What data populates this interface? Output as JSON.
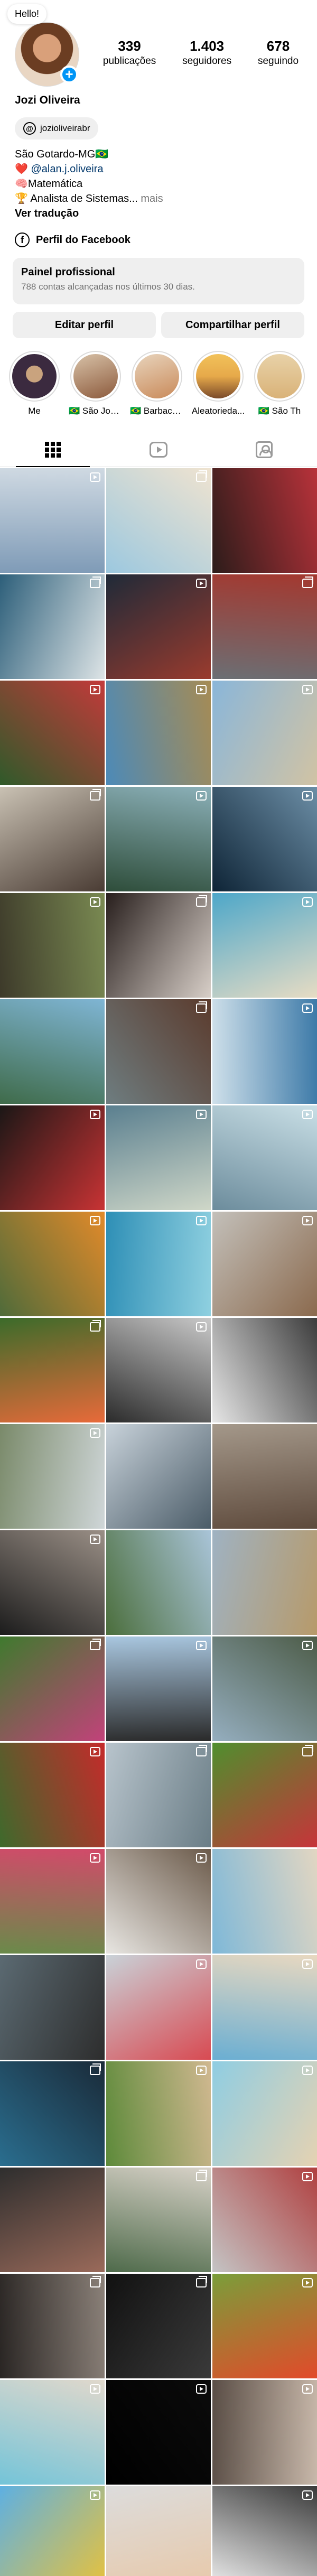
{
  "profile": {
    "note": "Hello!",
    "name": "Jozi Oliveira",
    "stats": [
      {
        "value": "339",
        "label": "publicações"
      },
      {
        "value": "1.403",
        "label": "seguidores"
      },
      {
        "value": "678",
        "label": "seguindo"
      }
    ],
    "threads_handle": "jozioliveirabr",
    "bio": {
      "line1": "São Gotardo-MG🇧🇷",
      "line2_prefix": "❤️ ",
      "line2_link": "@alan.j.oliveira",
      "line3": "🧠Matemática",
      "line4": "🏆 Analista de Sistemas...",
      "more": " mais",
      "translate": "Ver tradução"
    },
    "facebook_label": "Perfil do Facebook",
    "panel": {
      "title": "Painel profissional",
      "subtitle": "788 contas alcançadas nos últimos 30 dias."
    },
    "buttons": {
      "edit": "Editar perfil",
      "share": "Compartilhar perfil"
    }
  },
  "highlights": [
    {
      "label": "Me",
      "color": "#3b2a3f"
    },
    {
      "label": "🇧🇷 São Joã...",
      "color": "#8c5a3c"
    },
    {
      "label": "🇧🇷 Barbace...",
      "color": "#c98a5a"
    },
    {
      "label": "Aleatorieda...",
      "color": "#e6a94a"
    },
    {
      "label": "🇧🇷 São Th",
      "color": "#d9b278"
    }
  ],
  "posts": [
    {
      "c1": "#7f9bb7",
      "c2": "#cfd9e2",
      "badge": "reel"
    },
    {
      "c1": "#9cc8df",
      "c2": "#efe3d0",
      "badge": "carousel"
    },
    {
      "c1": "#2c1c1a",
      "c2": "#b8323a",
      "badge": "none"
    },
    {
      "c1": "#2d5f7a",
      "c2": "#dde4e6",
      "badge": "carousel"
    },
    {
      "c1": "#1f2a38",
      "c2": "#9a3b2e",
      "badge": "reel"
    },
    {
      "c1": "#6b6f74",
      "c2": "#a4382f",
      "badge": "carousel"
    },
    {
      "c1": "#2f5a2a",
      "c2": "#c33a3a",
      "badge": "reel"
    },
    {
      "c1": "#4c8ab8",
      "c2": "#a68b54",
      "badge": "reel"
    },
    {
      "c1": "#8ab6d9",
      "c2": "#d1c3a4",
      "badge": "reel"
    },
    {
      "c1": "#c9c1b3",
      "c2": "#4a3c34",
      "badge": "carousel"
    },
    {
      "c1": "#2e4d3a",
      "c2": "#8bb0b8",
      "badge": "reel"
    },
    {
      "c1": "#0e2436",
      "c2": "#6c8ea6",
      "badge": "reel"
    },
    {
      "c1": "#3d3a2a",
      "c2": "#7a8a52",
      "badge": "reel"
    },
    {
      "c1": "#281f1d",
      "c2": "#d8cfc8",
      "badge": "carousel"
    },
    {
      "c1": "#4da7c9",
      "c2": "#e7dcc4",
      "badge": "reel"
    },
    {
      "c1": "#3f6b4a",
      "c2": "#7fb5d4",
      "badge": "none"
    },
    {
      "c1": "#6e7d80",
      "c2": "#5b3b2d",
      "badge": "carousel"
    },
    {
      "c1": "#cfe0ea",
      "c2": "#3d7aa8",
      "badge": "reel"
    },
    {
      "c1": "#1b1716",
      "c2": "#c83334",
      "badge": "reel"
    },
    {
      "c1": "#5a7f8f",
      "c2": "#cfd7c8",
      "badge": "reel"
    },
    {
      "c1": "#6c8c9c",
      "c2": "#c9dfe6",
      "badge": "reel"
    },
    {
      "c1": "#4f6b3a",
      "c2": "#e28a2a",
      "badge": "reel"
    },
    {
      "c1": "#2e8fb6",
      "c2": "#8fd0e0",
      "badge": "reel"
    },
    {
      "c1": "#c3c0ba",
      "c2": "#8b6a4e",
      "badge": "reel"
    },
    {
      "c1": "#3b6b2a",
      "c2": "#e86a3a",
      "badge": "carousel"
    },
    {
      "c1": "#2b2b2b",
      "c2": "#c9c9c9",
      "badge": "reel"
    },
    {
      "c1": "#e6e6e6",
      "c2": "#3c3c3c",
      "badge": "none"
    },
    {
      "c1": "#7a8a6a",
      "c2": "#cfd6d8",
      "badge": "reel"
    },
    {
      "c1": "#c8d2da",
      "c2": "#4b5c68",
      "badge": "none"
    },
    {
      "c1": "#a4988a",
      "c2": "#5e4a3c",
      "badge": "none"
    },
    {
      "c1": "#1c1c1c",
      "c2": "#9a8f86",
      "badge": "reel"
    },
    {
      "c1": "#4b6e3c",
      "c2": "#a9c4d8",
      "badge": "none"
    },
    {
      "c1": "#9fb2c2",
      "c2": "#b79a6a",
      "badge": "none"
    },
    {
      "c1": "#3f7a2e",
      "c2": "#c2427a",
      "badge": "carousel"
    },
    {
      "c1": "#a9c7e0",
      "c2": "#2a2a2a",
      "badge": "reel"
    },
    {
      "c1": "#95aebf",
      "c2": "#4d5c48",
      "badge": "reel"
    },
    {
      "c1": "#3e6a2c",
      "c2": "#c42b2b",
      "badge": "reel"
    },
    {
      "c1": "#b8c4cc",
      "c2": "#6a7d86",
      "badge": "carousel"
    },
    {
      "c1": "#4f8f2e",
      "c2": "#c7343a",
      "badge": "carousel"
    },
    {
      "c1": "#6a8a4a",
      "c2": "#d24a6a",
      "badge": "reel"
    },
    {
      "c1": "#e8e6e2",
      "c2": "#6b5a4a",
      "badge": "reel"
    },
    {
      "c1": "#7eb8d8",
      "c2": "#e2d6c2",
      "badge": "none"
    },
    {
      "c1": "#5b6a72",
      "c2": "#2d2d2d",
      "badge": "none"
    },
    {
      "c1": "#c9d2d8",
      "c2": "#d84a52",
      "badge": "reel"
    },
    {
      "c1": "#6aaed2",
      "c2": "#e8d8c0",
      "badge": "reel"
    },
    {
      "c1": "#2a6e8f",
      "c2": "#1a2a38",
      "badge": "carousel"
    },
    {
      "c1": "#5d8a3a",
      "c2": "#d0b890",
      "badge": "reel"
    },
    {
      "c1": "#8fcde2",
      "c2": "#e5d2b2",
      "badge": "reel"
    },
    {
      "c1": "#2e2e2e",
      "c2": "#9a6a5a",
      "badge": "none"
    },
    {
      "c1": "#4e6a4a",
      "c2": "#d8d2c8",
      "badge": "carousel"
    },
    {
      "c1": "#c4c4c4",
      "c2": "#b04040",
      "badge": "reel"
    },
    {
      "c1": "#2a2624",
      "c2": "#8a8078",
      "badge": "carousel"
    },
    {
      "c1": "#111111",
      "c2": "#3a3a3a",
      "badge": "carousel"
    },
    {
      "c1": "#7a9e3a",
      "c2": "#e24a2a",
      "badge": "reel"
    },
    {
      "c1": "#74c4d8",
      "c2": "#e0d8cc",
      "badge": "reel"
    },
    {
      "c1": "#000000",
      "c2": "#0b0b0b",
      "badge": "reel"
    },
    {
      "c1": "#5a4e46",
      "c2": "#c8b8aa",
      "badge": "reel"
    },
    {
      "c1": "#5eb0e2",
      "c2": "#e9c23a",
      "badge": "reel"
    },
    {
      "c1": "#dcdcdc",
      "c2": "#e8c8a8",
      "badge": "none"
    },
    {
      "c1": "#f2f2f2",
      "c2": "#3a3a3a",
      "badge": "reel"
    }
  ],
  "tabs": [
    {
      "name": "posts"
    },
    {
      "name": "reels"
    },
    {
      "name": "tagged"
    }
  ]
}
